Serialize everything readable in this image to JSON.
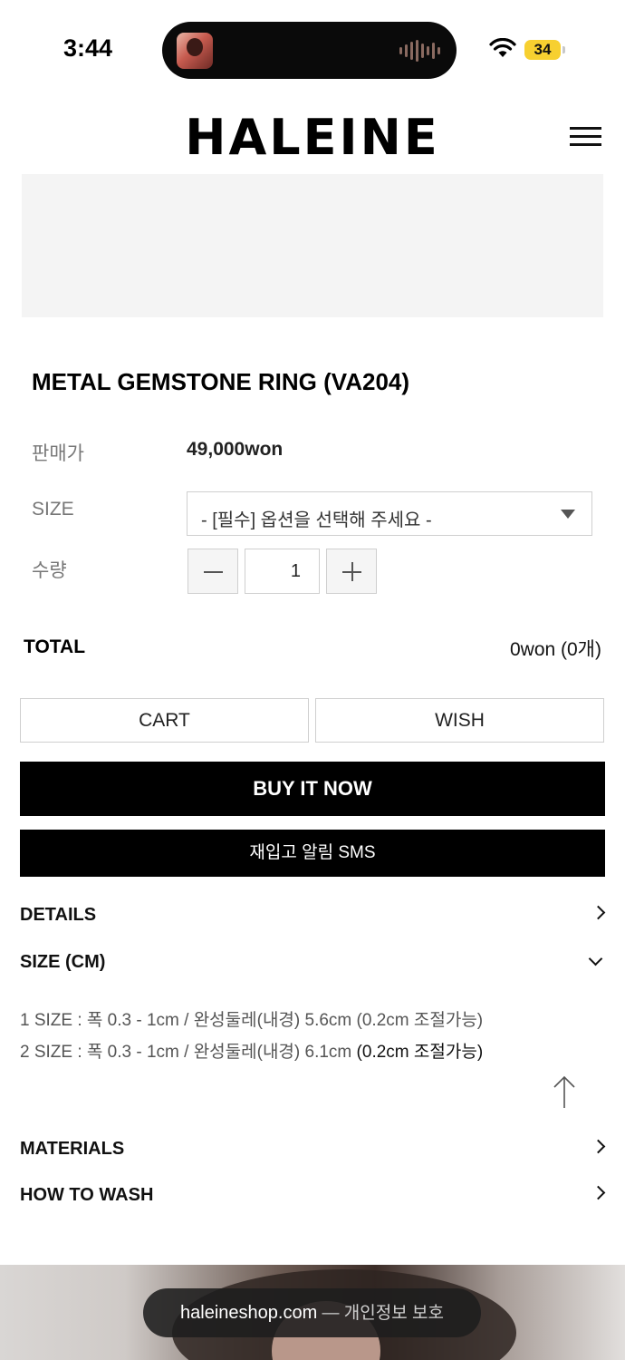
{
  "status_bar": {
    "time": "3:44",
    "battery": "34"
  },
  "header": {
    "logo": "HALEINE"
  },
  "product": {
    "title": "METAL GEMSTONE RING (VA204)",
    "price_label": "판매가",
    "price_value": "49,000won",
    "size_label": "SIZE",
    "size_select_value": "- [필수] 옵션을 선택해 주세요 -",
    "qty_label": "수량",
    "qty_value": "1",
    "total_label": "TOTAL",
    "total_value": "0won (0개)"
  },
  "actions": {
    "cart": "CART",
    "wish": "WISH",
    "buy_now": "BUY IT NOW",
    "restock_sms": "재입고 알림 SMS"
  },
  "accordions": {
    "details": "DETAILS",
    "size_cm": "SIZE (CM)",
    "size_line_1": "1 SIZE : 폭 0.3 - 1cm / 완성둘레(내경) 5.6cm (0.2cm 조절가능)",
    "size_line_2_main": "2 SIZE : 폭 0.3 - 1cm / 완성둘레(내경) 6.1cm ",
    "size_line_2_tail": "(0.2cm 조절가능)",
    "materials": "MATERIALS",
    "how_to_wash": "HOW TO WASH"
  },
  "browser": {
    "domain": "haleineshop.com",
    "privacy": " — 개인정보 보호"
  },
  "icons": {
    "menu": "hamburger-icon",
    "wifi": "wifi-icon",
    "scroll_top": "arrow-up-icon",
    "select": "caret-down-icon",
    "chevron": "chevron-right-icon"
  }
}
